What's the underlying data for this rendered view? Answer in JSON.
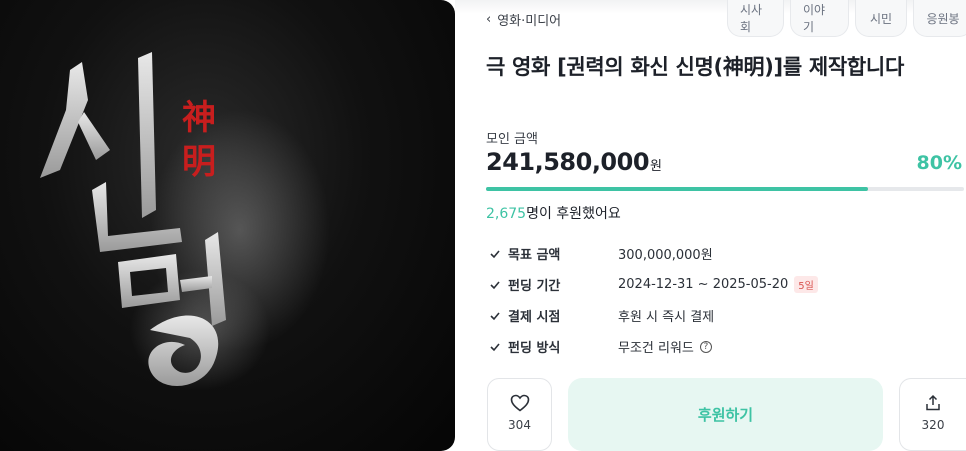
{
  "tabs": [
    "시사회",
    "이야기",
    "시민",
    "응원봉"
  ],
  "breadcrumb": "영화·미디어",
  "title": "극 영화 [권력의 화신 신명(神明)]를 제작합니다",
  "funding": {
    "amount_label": "모인 금액",
    "amount": "241,580,000",
    "currency": "원",
    "percent": "80%",
    "progress": 0.8,
    "backer_count": "2,675",
    "backer_text": "명이 후원했어요"
  },
  "info": [
    {
      "key": "목표 금액",
      "value": "300,000,000원"
    },
    {
      "key": "펀딩 기간",
      "value": "2024-12-31 ~ 2025-05-20",
      "badge": "5일"
    },
    {
      "key": "결제 시점",
      "value": "후원 시 즉시 결제"
    },
    {
      "key": "펀딩 방식",
      "value": "무조건 리워드",
      "help": "?"
    }
  ],
  "actions": {
    "like_count": "304",
    "fund_label": "후원하기",
    "share_count": "320"
  },
  "poster": {
    "hanja_title": [
      "神",
      "明"
    ],
    "hangul_title": [
      "신",
      "명"
    ]
  },
  "colors": {
    "accent": "#3ec3a4",
    "badge": "#d9534f",
    "poster_bg": "#0b0b0b"
  }
}
